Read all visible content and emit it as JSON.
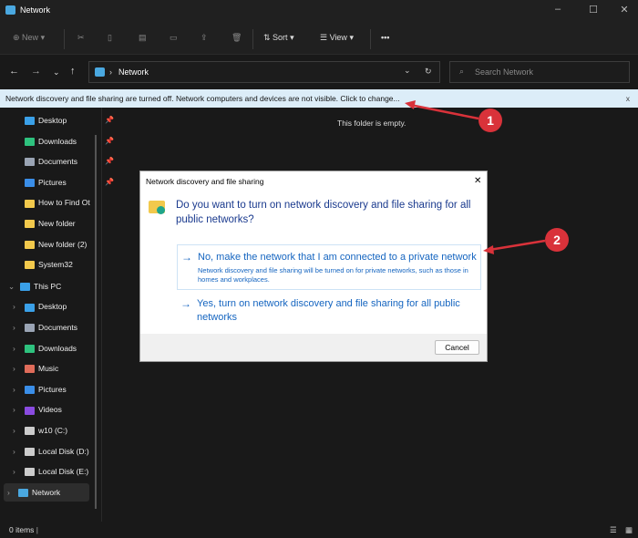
{
  "window": {
    "title": "Network",
    "minimize": "–",
    "maximize": "☐",
    "close": "✕"
  },
  "toolbar": {
    "new": "New",
    "sort": "Sort",
    "view": "View",
    "more": "•••"
  },
  "address": {
    "path": "Network",
    "search_placeholder": "Search Network"
  },
  "banner": {
    "text": "Network discovery and file sharing are turned off. Network computers and devices are not visible. Click to change...",
    "close": "x"
  },
  "sidebar": {
    "quick": [
      {
        "label": "Desktop",
        "color": "#3aa0e8",
        "pin": true
      },
      {
        "label": "Downloads",
        "color": "#2ec27e",
        "pin": true
      },
      {
        "label": "Documents",
        "color": "#9aa4b4",
        "pin": true
      },
      {
        "label": "Pictures",
        "color": "#3a8ee8",
        "pin": true
      },
      {
        "label": "How to Find Ot",
        "color": "#f2c94c"
      },
      {
        "label": "New folder",
        "color": "#f2c94c"
      },
      {
        "label": "New folder (2)",
        "color": "#f2c94c"
      },
      {
        "label": "System32",
        "color": "#f2c94c"
      }
    ],
    "this_pc": "This PC",
    "pc_items": [
      {
        "label": "Desktop",
        "color": "#3aa0e8"
      },
      {
        "label": "Documents",
        "color": "#9aa4b4"
      },
      {
        "label": "Downloads",
        "color": "#2ec27e"
      },
      {
        "label": "Music",
        "color": "#e06c5a"
      },
      {
        "label": "Pictures",
        "color": "#3a8ee8"
      },
      {
        "label": "Videos",
        "color": "#8a4be0"
      },
      {
        "label": "w10 (C:)",
        "color": "#ccc"
      },
      {
        "label": "Local Disk (D:)",
        "color": "#ccc"
      },
      {
        "label": "Local Disk (E:)",
        "color": "#ccc"
      }
    ],
    "network": "Network"
  },
  "main": {
    "empty": "This folder is empty."
  },
  "status": {
    "items": "0 items"
  },
  "dialog": {
    "title": "Network discovery and file sharing",
    "question": "Do you want to turn on network discovery and file sharing for all public networks?",
    "option1": "No, make the network that I am connected to a private network",
    "option1_desc": "Network discovery and file sharing will be turned on for private networks, such as those in homes and workplaces.",
    "option2": "Yes, turn on network discovery and file sharing for all public networks",
    "cancel": "Cancel",
    "close": "✕"
  },
  "callouts": [
    "1",
    "2"
  ]
}
